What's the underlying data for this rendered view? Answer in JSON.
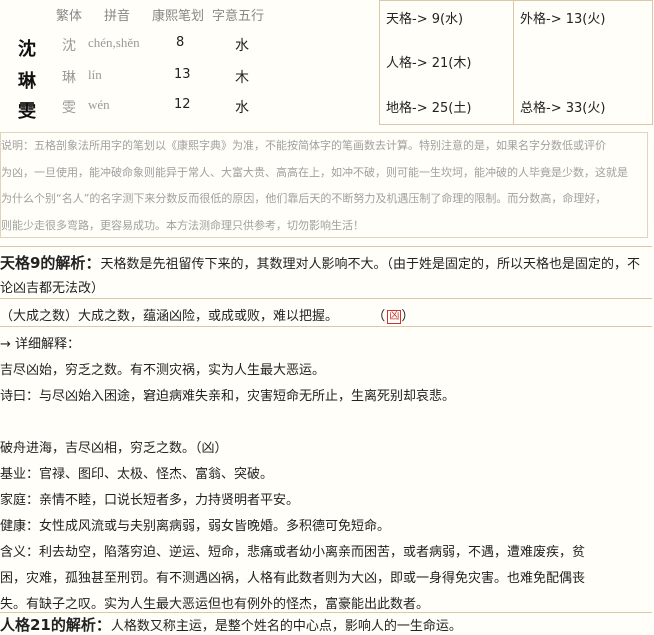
{
  "table": {
    "headers": [
      "繁体",
      "拼音",
      "康熙笔划",
      "字意五行"
    ],
    "rows": [
      {
        "simp": "沈",
        "trad": "沈",
        "pinyin": "chén,shěn",
        "strokes": "8",
        "element": "水"
      },
      {
        "simp": "琳",
        "trad": "琳",
        "pinyin": "lín",
        "strokes": "13",
        "element": "木"
      },
      {
        "simp": "雯",
        "trad": "雯",
        "pinyin": "wén",
        "strokes": "12",
        "element": "水"
      }
    ]
  },
  "ge": {
    "tian": "天格-> 9(水)",
    "wai": "外格-> 13(火)",
    "ren": "人格-> 21(木)",
    "di": "地格-> 25(土)",
    "zong": "总格-> 33(火)"
  },
  "note": [
    "说明：五格剖象法所用字的笔划以《康熙字典》为准，不能按简体字的笔画数去计算。特别注意的是，如果名字分数低或评价",
    "为凶，一旦使用，能冲破命象则能异于常人、大富大贵、高高在上，如冲不破，则可能一生坎坷，能冲破的人毕竟是少数，这就是",
    "为什么个别“名人”的名字测下来分数反而很低的原因，他们靠后天的不断努力及机遇压制了命理的限制。而分数高，命理好，",
    "则能少走很多弯路，更容易成功。本方法测命理只供参考，切勿影响生活！"
  ],
  "analysis": {
    "title": "天格9的解析：",
    "intro": "天格数是先祖留传下来的，其数理对人影响不大。（由于姓是固定的，所以天格也是固定的，不论凶吉都无法改）",
    "summary": "（大成之数）大成之数，蕴涵凶险，或成或败，难以把握。",
    "summary_mark": "凶",
    "detail_label": "→ 详细解释：",
    "lines": [
      "吉尽凶始，穷乏之数。有不测灾祸，实为人生最大恶运。",
      "诗曰：与尽凶始入困途，窘迫病难失亲和，灾害短命无所止，生离死别却哀悲。",
      "",
      "破舟进海，吉尽凶相，穷乏之数。（凶）",
      "基业：官禄、图印、太极、怪杰、富翁、突破。",
      "家庭：亲情不睦，口说长短者多，力持贤明者平安。",
      "健康：女性成风流或与夫别离病弱，弱女皆晚婚。多积德可免短命。",
      "含义：利去劫空，陷落穷迫、逆运、短命，悲痛或者幼小离亲而困苦，或者病弱，不遇，遭难废疾，贫",
      "困，灾难，孤独甚至刑罚。有不测遇凶祸，人格有此数者则为大凶，即或一身得免灾害。也难免配偶丧",
      "失。有缺子之叹。实为人生最大恶运但也有例外的怪杰，富豪能出此数者。"
    ],
    "next_title": "人格21的解析：",
    "next_intro": "人格数又称主运，是整个姓名的中心点，影响人的一生命运。"
  }
}
